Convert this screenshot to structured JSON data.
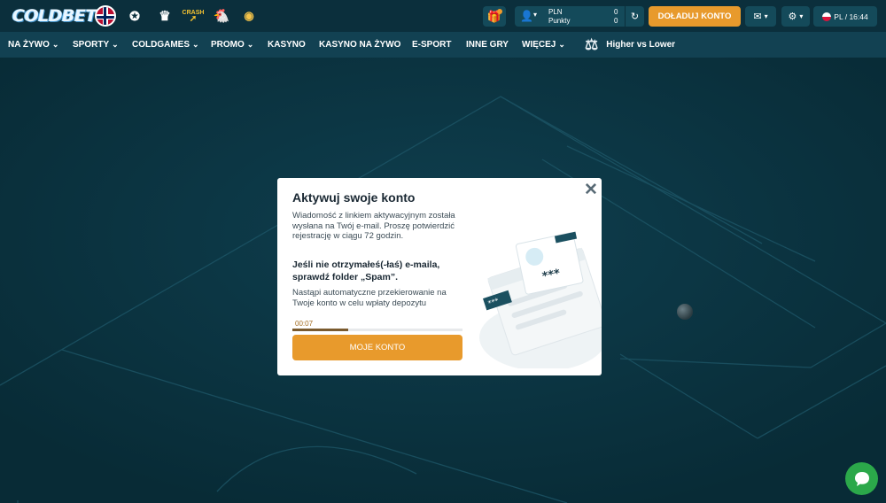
{
  "brand": {
    "logo_text": "COLDBET"
  },
  "quick_links": [
    {
      "icon": "norway-flag-icon"
    },
    {
      "icon": "champions-league-icon"
    },
    {
      "icon": "premier-league-icon"
    },
    {
      "icon": "crash-game-icon",
      "label": "CRASH"
    },
    {
      "icon": "chicken-game-icon"
    },
    {
      "icon": "plinko-game-icon"
    }
  ],
  "header": {
    "balance": {
      "currency": "PLN",
      "points_label": "Punkty",
      "currency_value": "0",
      "points_value": "0"
    },
    "deposit_label": "DOŁADUJ KONTO",
    "lang_time": "PL / 16:44"
  },
  "nav": {
    "items": [
      {
        "label": "NA ŻYWO",
        "has_dropdown": true
      },
      {
        "label": "SPORTY",
        "has_dropdown": true
      },
      {
        "label": "COLDGAMES",
        "has_dropdown": true
      },
      {
        "label": "PROMO",
        "has_dropdown": true
      },
      {
        "label": "KASYNO",
        "has_dropdown": false
      },
      {
        "label": "KASYNO NA ŻYWO",
        "has_dropdown": false
      },
      {
        "label": "E-SPORT",
        "has_dropdown": false
      },
      {
        "label": "INNE GRY",
        "has_dropdown": false
      },
      {
        "label": "WIĘCEJ",
        "has_dropdown": true
      }
    ],
    "featured": "Higher vs Lower"
  },
  "modal": {
    "title": "Aktywuj swoje konto",
    "text1": "Wiadomość z linkiem aktywacyjnym została wysłana na Twój e-mail. Proszę potwierdzić rejestrację w ciągu 72 godzin.",
    "bold_text": "Jeśli nie otrzymałeś(-łaś) e-maila, sprawdź folder „Spam”.",
    "text2": "Nastąpi automatyczne przekierowanie na Twoje konto w celu wpłaty depozytu",
    "timer": "00:07",
    "progress": 0.33,
    "button_label": "MOJE KONTO"
  },
  "colors": {
    "background": "#0a3340",
    "nav": "#124152",
    "accent": "#e89a2c",
    "chat": "#2ba84a"
  }
}
